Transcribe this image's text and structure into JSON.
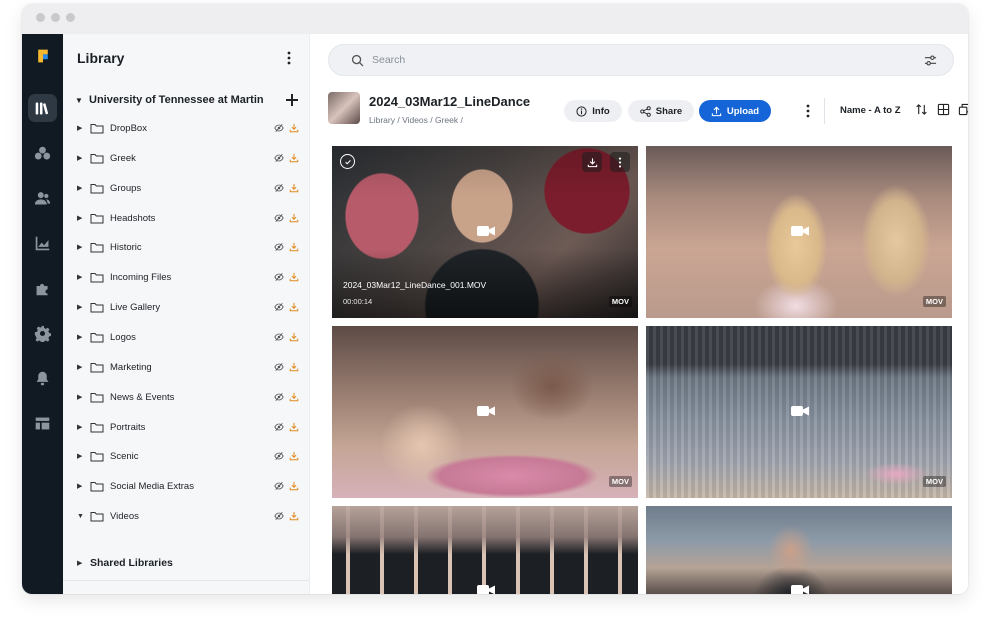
{
  "sidebar": {
    "title": "Library",
    "org_name": "University of Tennessee at Martin",
    "folders": [
      {
        "label": "DropBox"
      },
      {
        "label": "Greek"
      },
      {
        "label": "Groups"
      },
      {
        "label": "Headshots"
      },
      {
        "label": "Historic"
      },
      {
        "label": "Incoming Files"
      },
      {
        "label": "Live Gallery"
      },
      {
        "label": "Logos"
      },
      {
        "label": "Marketing"
      },
      {
        "label": "News & Events"
      },
      {
        "label": "Portraits"
      },
      {
        "label": "Scenic"
      },
      {
        "label": "Social Media Extras"
      },
      {
        "label": "Videos"
      }
    ],
    "shared_label": "Shared Libraries"
  },
  "rail": {
    "items": [
      "app-logo",
      "library-icon",
      "collections-icon",
      "users-icon",
      "analytics-icon",
      "integrations-icon",
      "settings-icon",
      "notifications-icon",
      "layout-icon"
    ]
  },
  "search": {
    "placeholder": "Search"
  },
  "asset": {
    "title": "2024_03Mar12_LineDance",
    "breadcrumb": "Library / Videos / Greek /"
  },
  "toolbar": {
    "info_label": "Info",
    "share_label": "Share",
    "upload_label": "Upload",
    "sort_label": "Name - A to Z"
  },
  "grid": {
    "items": [
      {
        "filename": "2024_03Mar12_LineDance_001.MOV",
        "duration": "00:00:14",
        "type": "MOV"
      },
      {
        "type": "MOV"
      },
      {
        "type": "MOV"
      },
      {
        "type": "MOV"
      },
      {
        "type": ""
      },
      {
        "type": ""
      }
    ]
  },
  "colors": {
    "accent": "#1565d8",
    "rail_bg": "#111a22",
    "download_icon": "#e08a1c"
  }
}
